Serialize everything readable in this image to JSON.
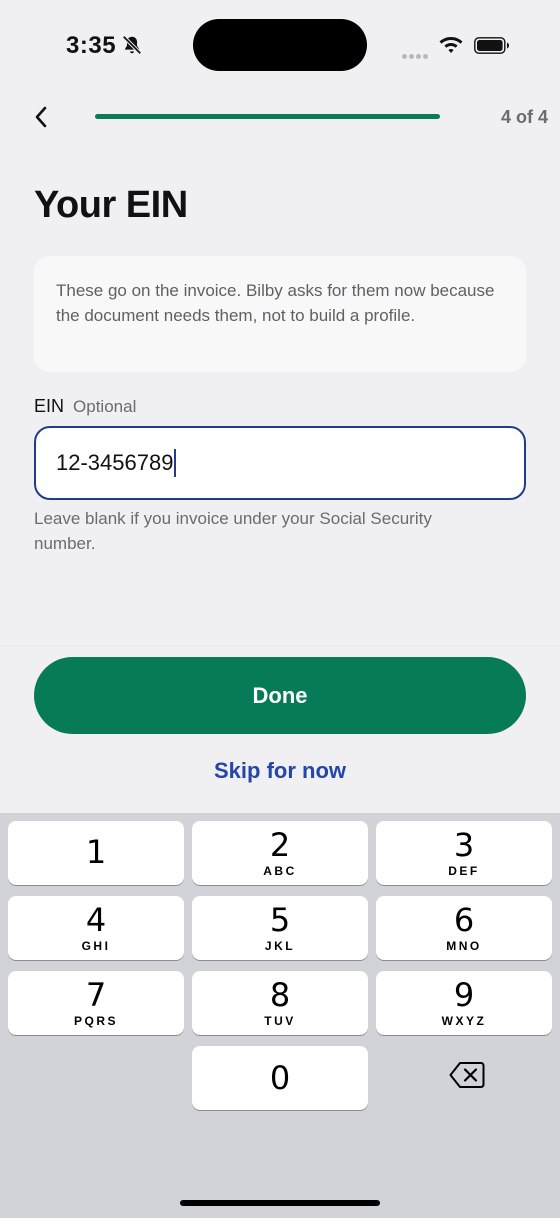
{
  "status": {
    "time": "3:35"
  },
  "nav": {
    "step": "4 of 4",
    "progress": 1.0
  },
  "page": {
    "title": "Your EIN"
  },
  "info": {
    "text": "These go on the invoice. Bilby asks for them now because the document needs them, not to build a profile."
  },
  "field": {
    "label": "EIN",
    "optional": "Optional",
    "value": "12-3456789",
    "helper": "Leave blank if you invoice under your Social Security number."
  },
  "actions": {
    "done": "Done",
    "skip": "Skip for now"
  },
  "keypad": {
    "keys": [
      {
        "digit": "1",
        "letters": ""
      },
      {
        "digit": "2",
        "letters": "ABC"
      },
      {
        "digit": "3",
        "letters": "DEF"
      },
      {
        "digit": "4",
        "letters": "GHI"
      },
      {
        "digit": "5",
        "letters": "JKL"
      },
      {
        "digit": "6",
        "letters": "MNO"
      },
      {
        "digit": "7",
        "letters": "PQRS"
      },
      {
        "digit": "8",
        "letters": "TUV"
      },
      {
        "digit": "9",
        "letters": "WXYZ"
      },
      {
        "digit": "0",
        "letters": ""
      }
    ]
  },
  "colors": {
    "accent": "#077a57",
    "link": "#2446a8",
    "focus": "#233a8f"
  }
}
